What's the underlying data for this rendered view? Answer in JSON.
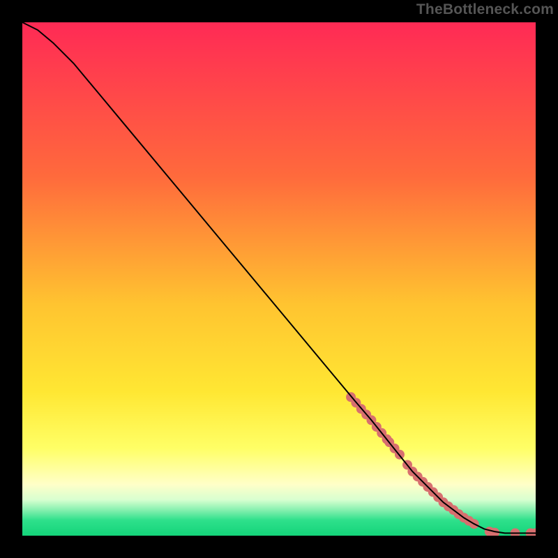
{
  "watermark": "TheBottleneck.com",
  "chart_data": {
    "type": "line",
    "title": "",
    "xlabel": "",
    "ylabel": "",
    "xlim": [
      0,
      100
    ],
    "ylim": [
      0,
      100
    ],
    "grid": false,
    "legend": false,
    "background_gradient_stops": [
      {
        "pos": 0.0,
        "color": "#ff2a55"
      },
      {
        "pos": 0.3,
        "color": "#ff6a3c"
      },
      {
        "pos": 0.55,
        "color": "#ffc430"
      },
      {
        "pos": 0.72,
        "color": "#ffe733"
      },
      {
        "pos": 0.83,
        "color": "#ffff66"
      },
      {
        "pos": 0.9,
        "color": "#ffffc8"
      },
      {
        "pos": 0.93,
        "color": "#d8ffd0"
      },
      {
        "pos": 0.95,
        "color": "#86f0af"
      },
      {
        "pos": 0.97,
        "color": "#2ee08b"
      },
      {
        "pos": 1.0,
        "color": "#14d47a"
      }
    ],
    "series": [
      {
        "name": "curve",
        "color": "#000000",
        "stroke_width": 2,
        "x": [
          0,
          3,
          6,
          10,
          15,
          20,
          30,
          40,
          50,
          60,
          65,
          68,
          70,
          72,
          74,
          76,
          78,
          80,
          82,
          84,
          86,
          88,
          89,
          90,
          92,
          94,
          95,
          97,
          99,
          100
        ],
        "y": [
          100,
          98.5,
          96,
          92,
          86,
          80,
          68,
          56,
          44,
          32,
          26,
          22.5,
          20,
          17.5,
          15,
          12.5,
          10.5,
          8.5,
          6.5,
          5,
          3.5,
          2.3,
          1.8,
          1.3,
          0.8,
          0.5,
          0.5,
          0.5,
          0.5,
          0.5
        ]
      }
    ],
    "markers": {
      "name": "highlight-dots",
      "color": "#d76f6f",
      "radius": 7,
      "points": [
        {
          "x": 64.0,
          "y": 27.0
        },
        {
          "x": 65.0,
          "y": 25.9
        },
        {
          "x": 66.0,
          "y": 24.7
        },
        {
          "x": 67.0,
          "y": 23.6
        },
        {
          "x": 68.0,
          "y": 22.5
        },
        {
          "x": 69.0,
          "y": 21.2
        },
        {
          "x": 70.0,
          "y": 20.0
        },
        {
          "x": 71.0,
          "y": 18.8
        },
        {
          "x": 71.5,
          "y": 18.2
        },
        {
          "x": 72.5,
          "y": 17.0
        },
        {
          "x": 73.5,
          "y": 15.8
        },
        {
          "x": 75.0,
          "y": 13.8
        },
        {
          "x": 76.0,
          "y": 12.5
        },
        {
          "x": 77.0,
          "y": 11.5
        },
        {
          "x": 78.0,
          "y": 10.5
        },
        {
          "x": 79.0,
          "y": 9.5
        },
        {
          "x": 80.0,
          "y": 8.5
        },
        {
          "x": 81.0,
          "y": 7.5
        },
        {
          "x": 82.0,
          "y": 6.5
        },
        {
          "x": 83.0,
          "y": 5.7
        },
        {
          "x": 84.0,
          "y": 5.0
        },
        {
          "x": 85.0,
          "y": 4.2
        },
        {
          "x": 86.0,
          "y": 3.5
        },
        {
          "x": 87.0,
          "y": 2.9
        },
        {
          "x": 88.0,
          "y": 2.3
        },
        {
          "x": 91.0,
          "y": 0.8
        },
        {
          "x": 92.0,
          "y": 0.6
        },
        {
          "x": 96.0,
          "y": 0.5
        },
        {
          "x": 99.0,
          "y": 0.5
        },
        {
          "x": 100.0,
          "y": 0.5
        }
      ]
    }
  }
}
